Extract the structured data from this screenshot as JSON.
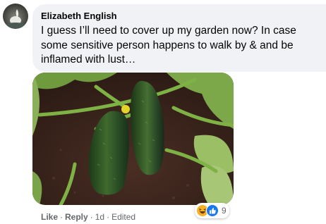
{
  "comment": {
    "author": "Elizabeth English",
    "text": "I guess I’ll need to cover up my garden now? In case some sensitive person happens to walk by & and be inflamed with lust…",
    "actions": {
      "like": "Like",
      "reply": "Reply",
      "time": "1d",
      "edited": "Edited",
      "separator": "·"
    },
    "reactions": {
      "icons": [
        "haha-icon",
        "like-icon"
      ],
      "count": "9"
    }
  },
  "colors": {
    "bubble": "#f0f2f5",
    "text": "#050505",
    "secondary": "#65676b",
    "like_blue": "#1877f2",
    "haha_yellow": "#f7b125"
  }
}
